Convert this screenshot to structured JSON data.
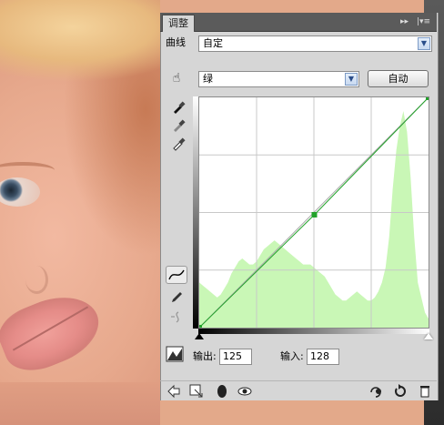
{
  "panel": {
    "tab_label": "调整",
    "tab_controls": "▸▸",
    "tab_close": "|▾≡"
  },
  "header": {
    "type_label": "曲线",
    "preset_value": "自定"
  },
  "channel": {
    "value": "绿",
    "auto_label": "自动"
  },
  "tools": {
    "hand_icon": "targeted-adjustment-hand-icon",
    "eyedroppers": [
      "black-eyedropper-icon",
      "gray-eyedropper-icon",
      "white-eyedropper-icon"
    ],
    "curve_modes": [
      "curve-point-icon",
      "pencil-icon",
      "smooth-icon"
    ]
  },
  "io": {
    "output_label": "输出:",
    "output_value": "125",
    "input_label": "输入:",
    "input_value": "128"
  },
  "colors": {
    "histogram_fill": "#c9f7b6",
    "curve": "#22a22a",
    "panel_bg": "#d6d6d6"
  },
  "curve": {
    "points": [
      [
        0,
        0
      ],
      [
        128,
        125
      ],
      [
        255,
        255
      ]
    ],
    "histogram": [
      30,
      28,
      26,
      24,
      22,
      20,
      22,
      26,
      30,
      36,
      40,
      44,
      46,
      44,
      42,
      42,
      44,
      48,
      52,
      54,
      56,
      58,
      56,
      54,
      52,
      50,
      48,
      46,
      44,
      42,
      42,
      42,
      40,
      38,
      36,
      34,
      30,
      26,
      22,
      20,
      18,
      18,
      20,
      22,
      24,
      22,
      20,
      18,
      18,
      20,
      24,
      30,
      40,
      60,
      92,
      118,
      134,
      144,
      130,
      100,
      60,
      30,
      20,
      10,
      6
    ]
  },
  "bottom_bar": {
    "left_icons": [
      "back-arrow-icon",
      "clip-to-layer-icon",
      "layer-mask-icon",
      "visibility-eye-icon"
    ],
    "right_icons": [
      "view-previous-state-icon",
      "reset-icon",
      "trash-icon"
    ]
  }
}
